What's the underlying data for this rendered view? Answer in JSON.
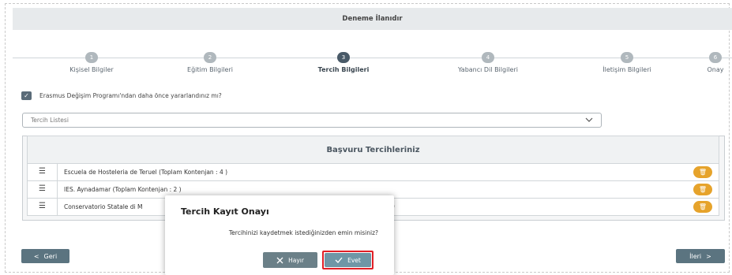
{
  "banner": {
    "title": "Deneme İlanıdır"
  },
  "steps": [
    {
      "num": "1",
      "label": "Kişisel Bilgiler",
      "active": false
    },
    {
      "num": "2",
      "label": "Eğitim Bilgileri",
      "active": false
    },
    {
      "num": "3",
      "label": "Tercih Bilgileri",
      "active": true
    },
    {
      "num": "4",
      "label": "Yabancı Dil Bilgileri",
      "active": false
    },
    {
      "num": "5",
      "label": "İletişim Bilgileri",
      "active": false
    },
    {
      "num": "6",
      "label": "Onay",
      "active": false
    }
  ],
  "erasmus": {
    "label": "Erasmus Değişim Programı'ndan daha önce yararlandınız mı?",
    "checked": true
  },
  "select": {
    "placeholder": "Tercih Listesi"
  },
  "table": {
    "header": "Başvuru Tercihleriniz",
    "rows": [
      "Escuela de Hosteleria de Teruel (Toplam Kontenjan : 4 )",
      "IES. Aynadamar (Toplam Kontenjan : 2 )",
      "Conservatorio Statale di M"
    ],
    "row3_tail": ")"
  },
  "nav": {
    "back": "Geri",
    "next": "İleri"
  },
  "modal": {
    "title": "Tercih Kayıt Onayı",
    "message": "Tercihinizi kaydetmek istediğinizden emin misiniz?",
    "no": "Hayır",
    "yes": "Evet"
  },
  "colors": {
    "accent": "#495a68",
    "delete": "#e6a32b",
    "highlight": "#e01f26"
  }
}
